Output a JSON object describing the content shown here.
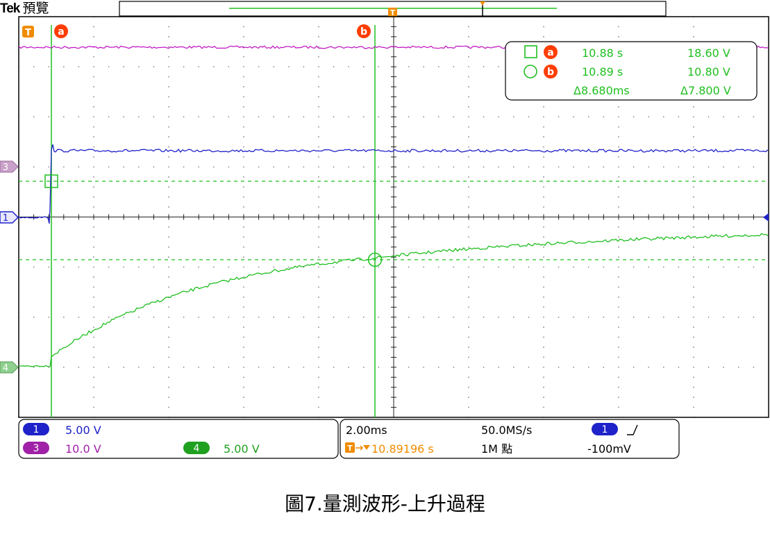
{
  "header": {
    "brand": "Tek",
    "mode": "預覽"
  },
  "colors": {
    "ch1": "#1e22c8",
    "ch3": "#c21cc4",
    "ch4": "#1fbf1f",
    "cursor": "#1fbf1f",
    "trigger": "#f08c00",
    "cursor_marker": "#ff3d00",
    "grid": "#7a7a7a",
    "panel_border": "#000000"
  },
  "markers": {
    "trigger": "T",
    "cursor_a": "a",
    "cursor_b": "b",
    "ch1": "1",
    "ch3": "3",
    "ch4": "4"
  },
  "cursor_readout": {
    "a": {
      "time": "10.88 s",
      "volt": "18.60 V"
    },
    "b": {
      "time": "10.89 s",
      "volt": "10.80 V"
    },
    "delta": {
      "time": "Δ8.680ms",
      "volt": "Δ7.800 V"
    }
  },
  "channel_panel": {
    "ch1": {
      "label": "1",
      "scale": "5.00 V"
    },
    "ch3": {
      "label": "3",
      "scale": "10.0 V"
    },
    "ch4": {
      "label": "4",
      "scale": "5.00 V"
    }
  },
  "timebase_panel": {
    "time_div": "2.00ms",
    "sample_rate": "50.0MS/s",
    "trigger_pos": "10.89196 s",
    "record_length": "1M 點",
    "trigger_channel": "1",
    "trigger_level": "-100mV"
  },
  "caption": "圖7.量測波形-上升過程"
}
